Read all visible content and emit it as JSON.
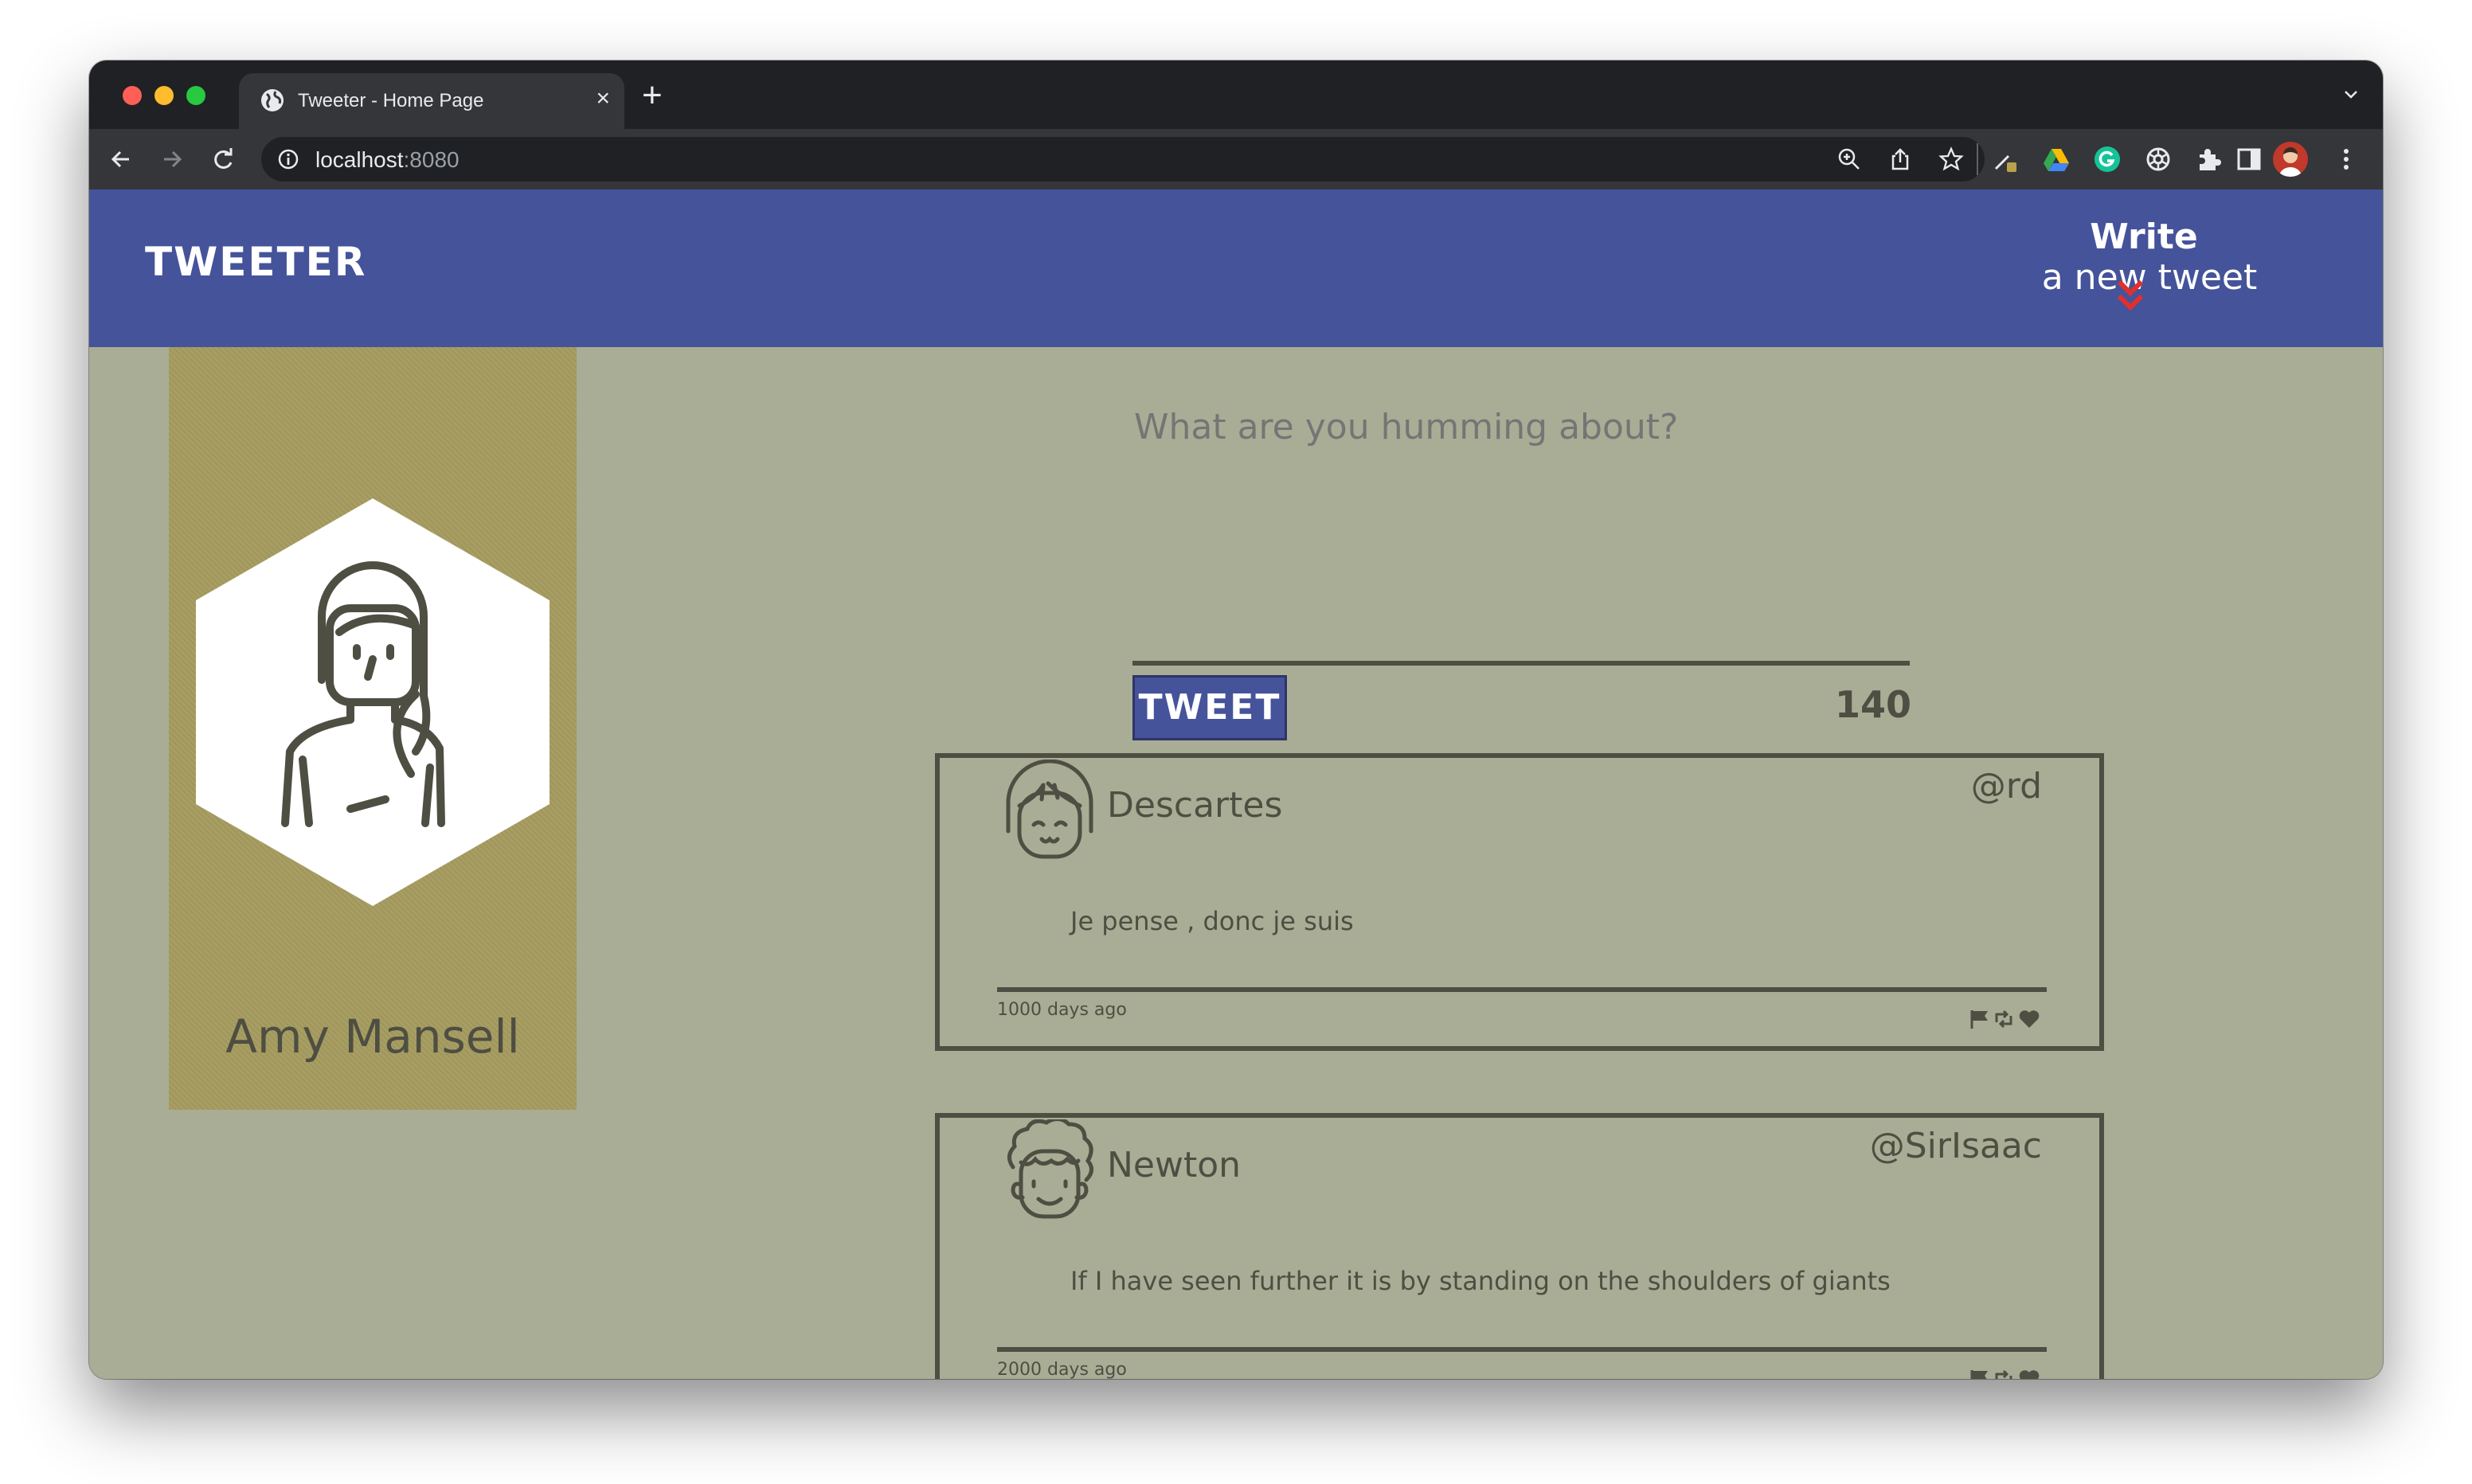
{
  "browser": {
    "tab_title": "Tweeter - Home Page",
    "url_host": "localhost",
    "url_port": ":8080"
  },
  "nav": {
    "brand": "TWEETER",
    "write_bold": "Write",
    "write_rest": " a new tweet"
  },
  "profile": {
    "name": "Amy Mansell"
  },
  "composer": {
    "placeholder": "What are you humming about?",
    "button_label": "TWEET",
    "counter": "140"
  },
  "tweets": [
    {
      "name": "Descartes",
      "handle": "@rd",
      "text": "Je pense , donc je suis",
      "age": "1000 days ago"
    },
    {
      "name": "Newton",
      "handle": "@SirIsaac",
      "text": "If I have seen further it is by standing on the shoulders of giants",
      "age": "2000 days ago"
    }
  ],
  "colors": {
    "nav_bg": "#45539a",
    "page_bg": "#a9ad95",
    "profile_bg": "#a59b5f",
    "ink": "#4e4e42",
    "accent_red": "#e0302b"
  },
  "icons": [
    "globe-icon",
    "close-icon",
    "plus-icon",
    "back-icon",
    "forward-icon",
    "reload-icon",
    "info-icon",
    "zoom-icon",
    "share-icon",
    "star-icon",
    "extensions-icon",
    "sidebar-icon",
    "menu-icon",
    "double-chevron-down-icon",
    "flag-icon",
    "retweet-icon",
    "heart-icon"
  ]
}
